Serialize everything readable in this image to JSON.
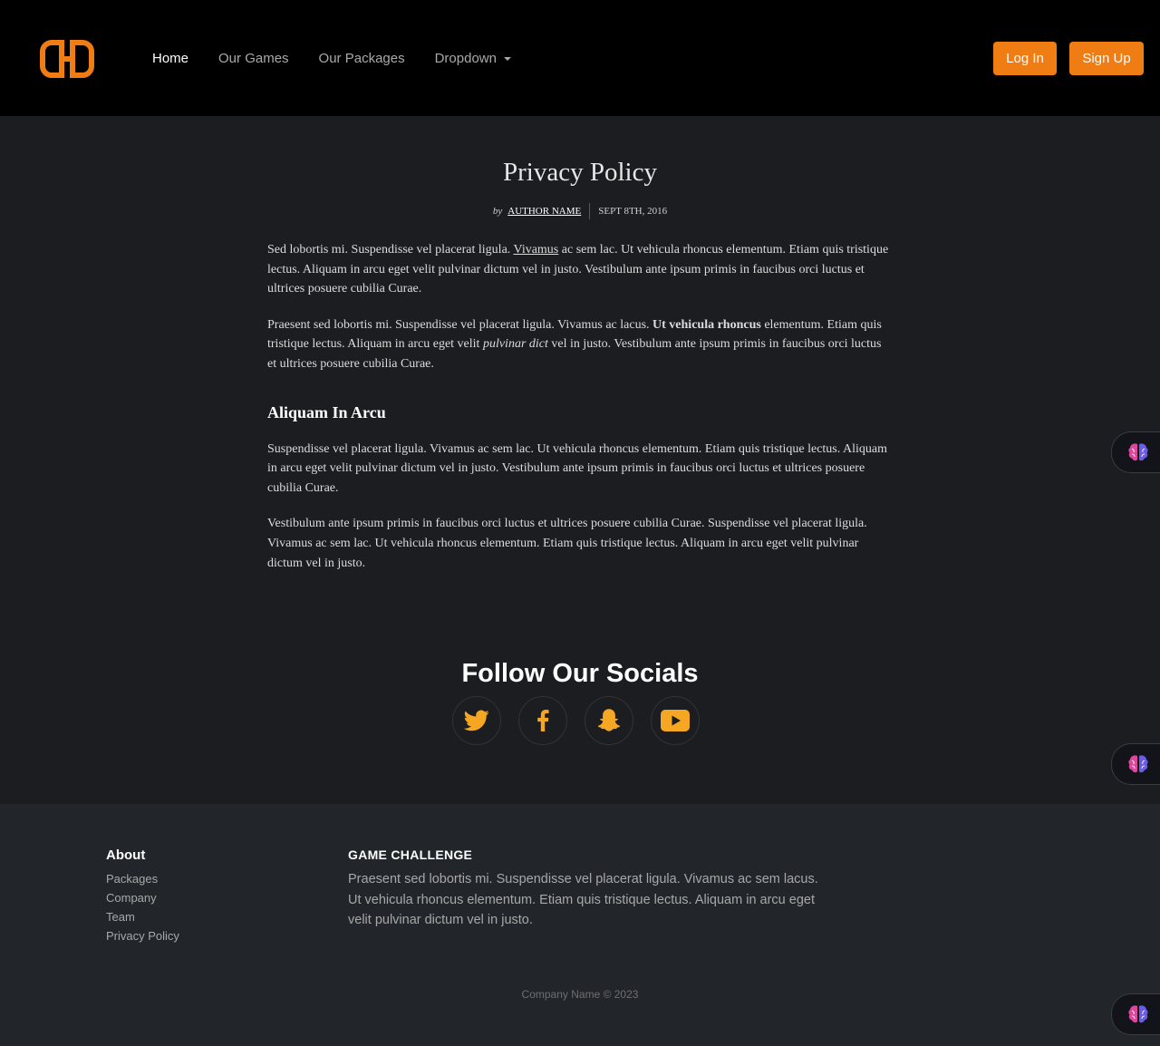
{
  "nav": {
    "items": [
      {
        "label": "Home"
      },
      {
        "label": "Our Games"
      },
      {
        "label": "Our Packages"
      },
      {
        "label": "Dropdown"
      }
    ],
    "login_label": "Log In",
    "signup_label": "Sign Up"
  },
  "article": {
    "title": "Privacy Policy",
    "by": "by",
    "author": "Author Name",
    "date": "Sept 8th, 2016",
    "p1_before": "Sed lobortis mi. Suspendisse vel placerat ligula. ",
    "p1_link": "Vivamus",
    "p1_after": " ac sem lac. Ut vehicula rhoncus elementum. Etiam quis tristique lectus. Aliquam in arcu eget velit pulvinar dictum vel in justo. Vestibulum ante ipsum primis in faucibus orci luctus et ultrices posuere cubilia Curae.",
    "p2_a": "Praesent sed lobortis mi. Suspendisse vel placerat ligula. Vivamus ac lacus. ",
    "p2_bold": "Ut vehicula rhoncus",
    "p2_b": " elementum. Etiam quis tristique lectus. Aliquam in arcu eget velit ",
    "p2_italic": "pulvinar dict",
    "p2_c": " vel in justo. Vestibulum ante ipsum primis in faucibus orci luctus et ultrices posuere cubilia Curae.",
    "heading": "Aliquam In Arcu",
    "p3": "Suspendisse vel placerat ligula. Vivamus ac sem lac. Ut vehicula rhoncus elementum. Etiam quis tristique lectus. Aliquam in arcu eget velit pulvinar dictum vel in justo. Vestibulum ante ipsum primis in faucibus orci luctus et ultrices posuere cubilia Curae.",
    "p4": "Vestibulum ante ipsum primis in faucibus orci luctus et ultrices posuere cubilia Curae. Suspendisse vel placerat ligula. Vivamus ac sem lac. Ut vehicula rhoncus elementum. Etiam quis tristique lectus. Aliquam in arcu eget velit pulvinar dictum vel in justo."
  },
  "socials": {
    "title": "Follow Our Socials",
    "icons": [
      "twitter-icon",
      "facebook-icon",
      "snapchat-icon",
      "youtube-icon"
    ]
  },
  "footer": {
    "about_heading": "About",
    "about_links": [
      "Packages",
      "Company",
      "Team",
      "Privacy Policy"
    ],
    "game_heading": "Game Challenge",
    "game_text": "Praesent sed lobortis mi. Suspendisse vel placerat ligula. Vivamus ac sem lacus. Ut vehicula rhoncus elementum. Etiam quis tristique lectus. Aliquam in arcu eget velit pulvinar dictum vel in justo.",
    "copyright": "Company Name © 2023"
  },
  "colors": {
    "accent": "#f07c14",
    "navbar_bg": "#000000",
    "page_bg": "#1c1d21",
    "footer_bg": "#22252a"
  },
  "floating_widgets": {
    "icon": "brain-icon",
    "count": 3
  }
}
